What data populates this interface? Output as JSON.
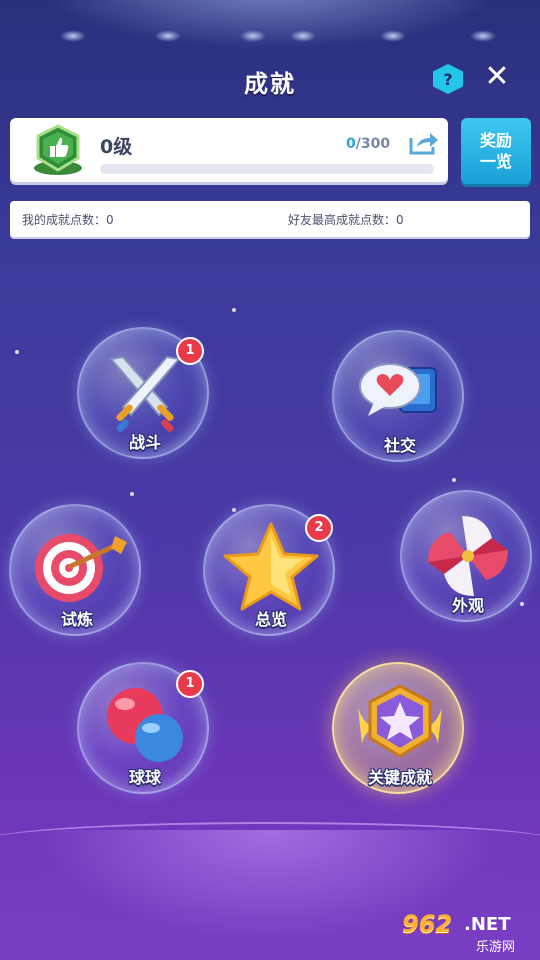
{
  "header": {
    "title": "成就",
    "help_label": "?",
    "close_label": "✕"
  },
  "level": {
    "name": "0级",
    "current": "0",
    "progress_text": "/300",
    "progress_fraction": 0,
    "badge_icon": "thumbs-up-badge-icon",
    "share_icon": "share-icon"
  },
  "reward_button": {
    "line1": "奖励",
    "line2": "一览"
  },
  "points": {
    "mine": "我的成就点数：0",
    "friends_best": "好友最高成就点数：0"
  },
  "categories": [
    {
      "label": "战斗",
      "badge": "1",
      "icon": "crossed-swords-icon"
    },
    {
      "label": "社交",
      "badge": "",
      "icon": "chat-heart-icon"
    },
    {
      "label": "试炼",
      "badge": "",
      "icon": "target-arrow-icon"
    },
    {
      "label": "总览",
      "badge": "2",
      "icon": "star-icon"
    },
    {
      "label": "外观",
      "badge": "",
      "icon": "pinwheel-icon"
    },
    {
      "label": "球球",
      "badge": "1",
      "icon": "balls-icon"
    },
    {
      "label": "关键成就",
      "badge": "",
      "icon": "star-medal-icon"
    }
  ],
  "watermark": {
    "number": "962",
    "domain": ".NET",
    "name": "乐游网"
  },
  "colors": {
    "accent": "#2aa6d8",
    "badge_red": "#e83a4a",
    "gold": "#ffc843"
  }
}
